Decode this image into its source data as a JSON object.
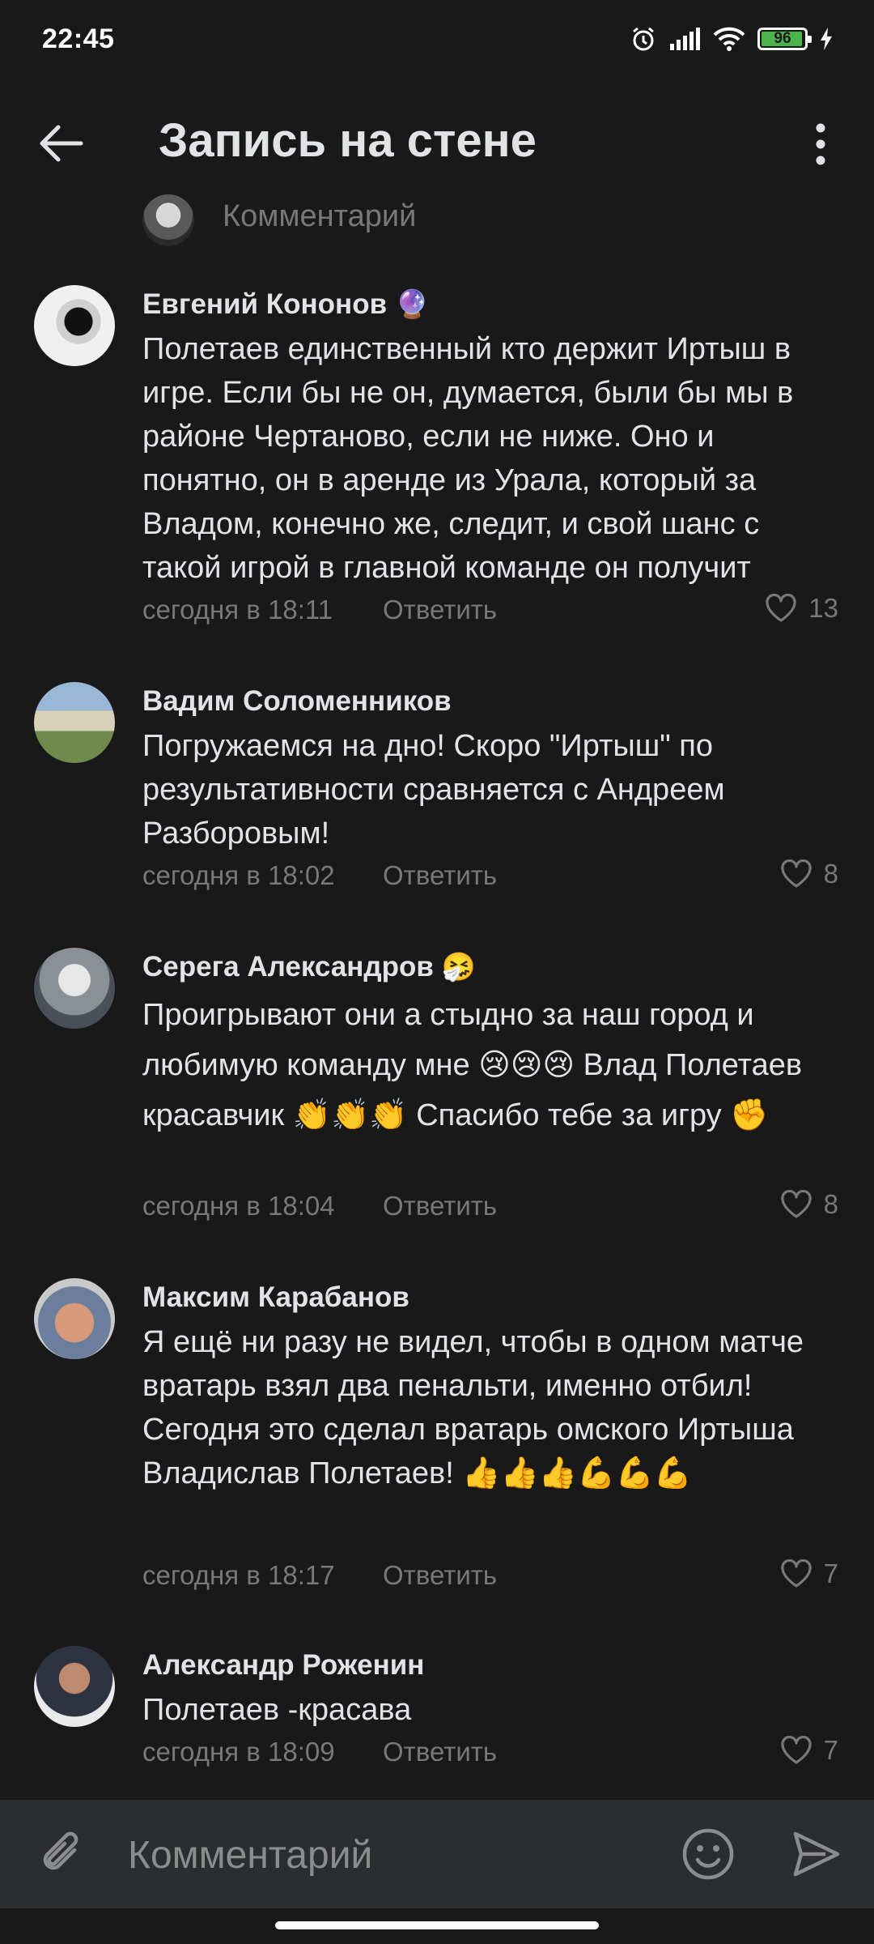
{
  "status_bar": {
    "time": "22:45",
    "battery": "96",
    "battery_level": 0.96,
    "icons": [
      "alarm-icon",
      "signal-icon",
      "wifi-icon",
      "battery-icon",
      "charging-icon"
    ]
  },
  "header": {
    "title": "Запись на стене",
    "back_icon": "arrow-left-icon",
    "menu_icon": "more-vertical-icon"
  },
  "reply_bar": {
    "placeholder": "Комментарий"
  },
  "comments": [
    {
      "author": "Евгений Кононов",
      "badge": "🔮",
      "text": "Полетаев единственный кто держит Иртыш в игре. Если бы не он, думается, были бы мы в районе Чертаново, если не ниже. Оно и понятно, он в аренде из Урала, который за Владом, конечно же, следит, и свой шанс с такой игрой в главной команде он получит",
      "time": "сегодня в 18:11",
      "reply": "Ответить",
      "likes": "13"
    },
    {
      "author": "Вадим Соломенников",
      "badge": "",
      "text": "Погружаемся на дно! Скоро \"Иртыш\" по результативности сравняется с Андреем Разборовым!",
      "time": "сегодня в 18:02",
      "reply": "Ответить",
      "likes": "8"
    },
    {
      "author": "Серега Александров",
      "badge": "🤧",
      "text": "Проигрывают они а стыдно за наш город и любимую команду мне 😢😢😢 Влад Полетаев красавчик  👏👏👏 Спасибо тебе за игру ✊",
      "time": "сегодня в 18:04",
      "reply": "Ответить",
      "likes": "8"
    },
    {
      "author": "Максим Карабанов",
      "badge": "",
      "text": "Я ещё ни разу не видел, чтобы в одном матче вратарь взял два пенальти, именно отбил! Сегодня это сделал вратарь омского Иртыша Владислав Полетаев! 👍👍👍💪💪💪",
      "time": "сегодня в 18:17",
      "reply": "Ответить",
      "likes": "7"
    },
    {
      "author": "Александр Роженин",
      "badge": "",
      "text": "Полетаев -красава",
      "time": "сегодня в 18:09",
      "reply": "Ответить",
      "likes": "7"
    }
  ],
  "composer": {
    "placeholder": "Комментарий",
    "attach_icon": "paperclip-icon",
    "emoji_icon": "smile-icon",
    "send_icon": "send-icon"
  }
}
